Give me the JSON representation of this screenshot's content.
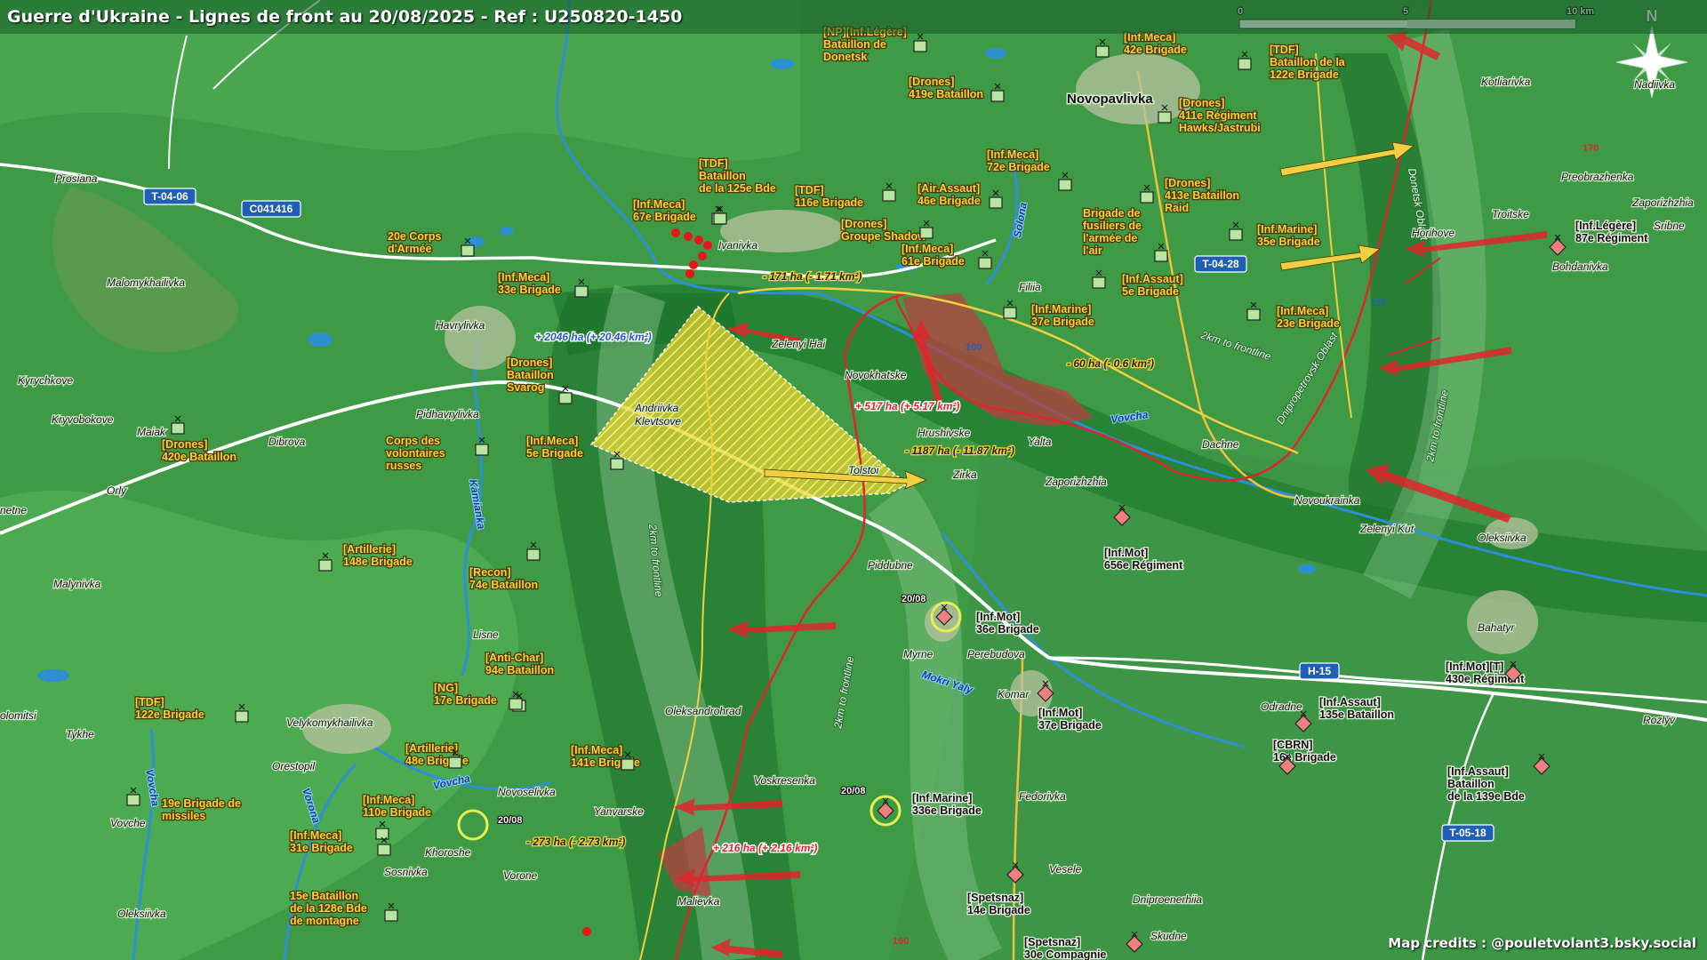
{
  "title": "Guerre d'Ukraine - Lignes de front au 20/08/2025 - Ref : U250820-1450",
  "credits": "Map credits : @pouletvolant3.bsky.social",
  "scale": {
    "ticks": [
      "0",
      "5",
      "10 km"
    ]
  },
  "compass": "N",
  "colors": {
    "ua_unit": "#f5d13a",
    "ru_front": "#e0242a",
    "ua_gain": "#e8d22c",
    "terrain": "#2f8a3c"
  },
  "towns": {
    "novopavlivka": "Novopavlivka",
    "prosiana": "Prosiana",
    "malomykhailivka": "Malomykhailivka",
    "kyrychkove": "Kyrychkove",
    "kryvobokove": "Kryvobokove",
    "maiak": "Maiak",
    "dibrova": "Dibrova",
    "orly": "Orly",
    "netne": "netne",
    "malynivka": "Malynivka",
    "havrylivka": "Havrylivka",
    "pidhavrylivka": "Pidhavrylivka",
    "andriivka": "Andriivka",
    "klevtsove": "Klevtsove",
    "ivanivka": "Ivanivka",
    "zelenyi_hai": "Zelenyi Hai",
    "novokhatske": "Novokhatske",
    "hrushivske": "Hrushivske",
    "yalta": "Yalta",
    "zirka": "Zirka",
    "tolstoi": "Tolstoi",
    "zaporizhzhia": "Zaporizhzhia",
    "filiia": "Filiia",
    "dachne": "Dachne",
    "novoukrainka": "Novoukrainka",
    "zelenyi_kut": "Zelenyi Kut",
    "oleksiivka_e": "Oleksiivka",
    "kotliarivka": "Kotliarivka",
    "nadiivka": "Nadiivka",
    "preobrazhenka": "Preobrazhenka",
    "zaporizhzhia2": "Zaporizhzhia",
    "troitske": "Troitske",
    "horihove": "Horihove",
    "bohdanivka": "Bohdanivka",
    "sribne": "Sribne",
    "piddubne": "Piddubne",
    "myrne": "Myrne",
    "perebudova": "Perebudova",
    "komar": "Komar",
    "oleksandrohrad": "Oleksandrohrad",
    "lisne": "Lisne",
    "velykomykhailivka": "Velykomykhailivka",
    "tykhe": "Tykhe",
    "orestopil": "Orestopil",
    "olomitsi": "olomitsi",
    "vovche": "Vovche",
    "novoselivka": "Novoselivka",
    "yanvarske": "Yanvarske",
    "voskresenka": "Voskresenka",
    "khoroshe": "Khoroshe",
    "sosnivka": "Sosnivka",
    "vorone": "Vorone",
    "malievka": "Malievka",
    "oleksiivka_w": "Oleksiivka",
    "fedorivka": "Fedorivka",
    "vesele": "Vesele",
    "dniproenerhiia": "Dniproenerhiia",
    "skudne": "Skudne",
    "odradne": "Odradne",
    "bahatyr": "Bahatyr",
    "rozlyv": "Rozlyv"
  },
  "rivers": {
    "vovcha": "Vovcha",
    "solona": "Solona",
    "kamianka": "Kamianka",
    "mokri_yaly": "Mokri Yaly",
    "vovcha_w": "Vovcha",
    "vorona": "Vorona",
    "vovcha_sw": "Vovcha"
  },
  "roads": {
    "t0406": "T-04-06",
    "c041416": "C041416",
    "t0428": "T-04-28",
    "h15": "H-15",
    "t0518": "T-05-18",
    "r110": "110",
    "r100": "100",
    "r170": "170",
    "r160": "160"
  },
  "oblasts": {
    "donetsk": "Donetsk Oblast",
    "dnipro": "Dnipropetrovsk Oblast"
  },
  "frontline_labels": {
    "a": "2km to frontline",
    "b": "2km to frontline",
    "c": "2km to frontline",
    "d": "2km to frontline"
  },
  "changes": {
    "ua_2046": "+ 2046 ha (+ 20.46 km²)",
    "ru_517": "+ 517 ha (+ 5.17 km²)",
    "ru_216": "+ 216 ha (+ 2.16 km²)",
    "loss_171": "- 171 ha (- 1.71 km²)",
    "loss_60": "- 60 ha (- 0.6 km²)",
    "loss_1187": "- 1187 ha (- 11.87 km²)",
    "loss_273": "- 273 ha (- 2.73 km²)"
  },
  "dates": {
    "d1": "20/08",
    "d2": "20/08",
    "d3": "20/08"
  },
  "units_ua": {
    "u1": [
      "[NP][Inf.Légère]",
      "Bataillon de",
      "Donetsk"
    ],
    "u2": [
      "[Inf.Meca]",
      "42e Brigade"
    ],
    "u3": [
      "[TDF]",
      "Bataillon de la",
      "122e Brigade"
    ],
    "u4": [
      "[Drones]",
      "419e Bataillon"
    ],
    "u5": [
      "[Drones]",
      "411e Régiment",
      "Hawks/Jastrubi"
    ],
    "u6": [
      "[TDF]",
      "Bataillon",
      "de la 125e Bde"
    ],
    "u7": [
      "[Inf.Meca]",
      "72e Brigade"
    ],
    "u8": [
      "[Drones]",
      "413e Bataillon",
      "Raid"
    ],
    "u9": [
      "[Inf.Meca]",
      "67e Brigade"
    ],
    "u10": [
      "[TDF]",
      "116e Brigade"
    ],
    "u11": [
      "[Air.Assaut]",
      "46e Brigade"
    ],
    "u12": [
      "Brigade de",
      "fusiliers de",
      "l'armée de",
      "l'air"
    ],
    "u13": [
      "[Inf.Marine]",
      "35e Brigade"
    ],
    "u14": [
      "[Drones]",
      "Groupe Shadow"
    ],
    "u15": [
      "20e Corps",
      "d'Armée"
    ],
    "u16": [
      "[Inf.Meca]",
      "61e Brigade"
    ],
    "u17": [
      "[Inf.Assaut]",
      "5e Brigade"
    ],
    "u18": [
      "[Inf.Meca]",
      "33e Brigade"
    ],
    "u19": [
      "[Inf.Marine]",
      "37e Brigade"
    ],
    "u20": [
      "[Inf.Meca]",
      "23e Brigade"
    ],
    "u21": [
      "[Drones]",
      "Bataillon",
      "Svarog"
    ],
    "u22": [
      "[Drones]",
      "420e Bataillon"
    ],
    "u23": [
      "Corps des",
      "volontaires",
      "russes"
    ],
    "u24": [
      "[Inf.Meca]",
      "5e Brigade"
    ],
    "u25": [
      "[Artillerie]",
      "148e Brigade"
    ],
    "u26": [
      "[Recon]",
      "74e Bataillon"
    ],
    "u27": [
      "[Anti-Char]",
      "94e Bataillon"
    ],
    "u28": [
      "[NG]",
      "17e Brigade"
    ],
    "u29": [
      "[TDF]",
      "122e Brigade"
    ],
    "u30": [
      "[Artillerie]",
      "48e Brigade"
    ],
    "u31": [
      "[Inf.Meca]",
      "141e Brigade"
    ],
    "u32": [
      "19e Brigade de",
      "missiles"
    ],
    "u33": [
      "[Inf.Meca]",
      "110e Brigade"
    ],
    "u34": [
      "[Inf.Meca]",
      "31e Brigade"
    ],
    "u35": [
      "15e Bataillon",
      "de la 128e Bde",
      "de montagne"
    ]
  },
  "units_ru": {
    "r1": [
      "[Inf.Légère]",
      "87e Régiment"
    ],
    "r2": [
      "[Inf.Mot]",
      "656e Régiment"
    ],
    "r3": [
      "[Inf.Mot]",
      "36e Brigade"
    ],
    "r4": [
      "[Inf.Mot]",
      "37e Brigade"
    ],
    "r5": [
      "[Inf.Assaut]",
      "135e Bataillon"
    ],
    "r6": [
      "[CBRN]",
      "16e Brigade"
    ],
    "r7": [
      "[Inf.Mot][T]",
      "430e Régiment"
    ],
    "r8": [
      "[Inf.Assaut]",
      "Bataillon",
      "de la 139e Bde"
    ],
    "r9": [
      "[Inf.Marine]",
      "336e Brigade"
    ],
    "r10": [
      "[Spetsnaz]",
      "14e Brigade"
    ],
    "r11": [
      "[Spetsnaz]",
      "30e Compagnie"
    ]
  }
}
